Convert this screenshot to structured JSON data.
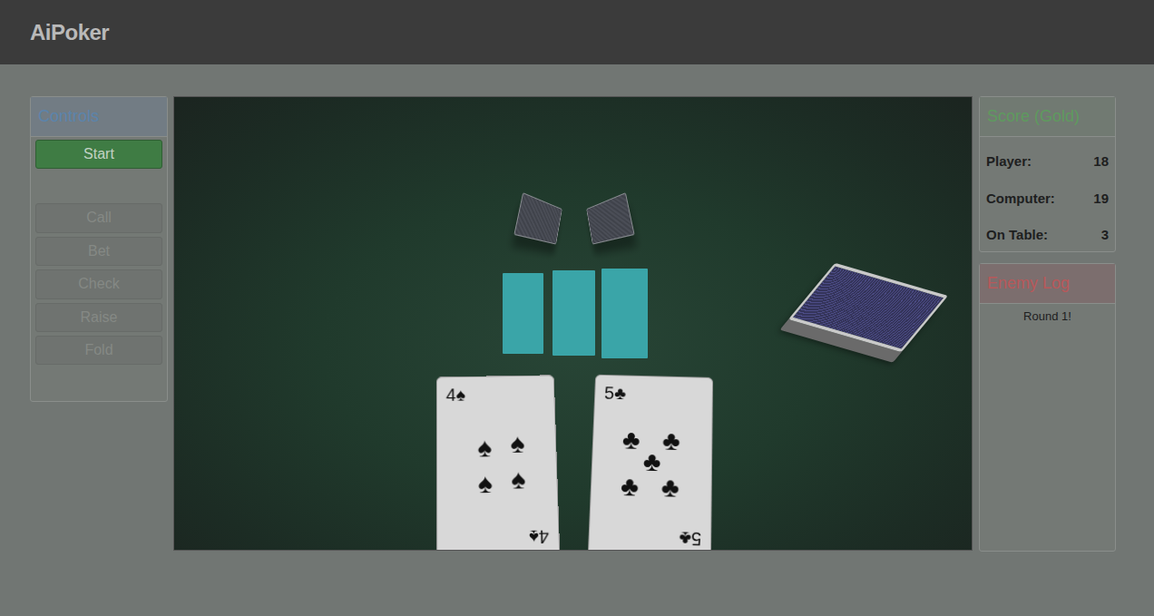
{
  "app": {
    "brand": "AiPoker"
  },
  "controls": {
    "title": "Controls",
    "start": {
      "label": "Start",
      "disabled": false
    },
    "actions": [
      {
        "label": "Call",
        "disabled": true
      },
      {
        "label": "Bet",
        "disabled": true
      },
      {
        "label": "Check",
        "disabled": true
      },
      {
        "label": "Raise",
        "disabled": true
      },
      {
        "label": "Fold",
        "disabled": true
      }
    ]
  },
  "table": {
    "opponent_cards": [
      {
        "face_down": true
      },
      {
        "face_down": true
      }
    ],
    "community_slots": [
      {
        "filled": false
      },
      {
        "filled": false
      },
      {
        "filled": false
      }
    ],
    "deck": {
      "face_down": true
    },
    "player_cards": [
      {
        "rank": "4",
        "suit": "♠"
      },
      {
        "rank": "5",
        "suit": "♣"
      }
    ]
  },
  "score": {
    "title": "Score (Gold)",
    "rows": [
      {
        "label": "Player:",
        "value": "18"
      },
      {
        "label": "Computer:",
        "value": "19"
      },
      {
        "label": "On Table:",
        "value": "3"
      }
    ]
  },
  "enemy_log": {
    "title": "Enemy Log",
    "entries": [
      "Round 1!"
    ]
  }
}
